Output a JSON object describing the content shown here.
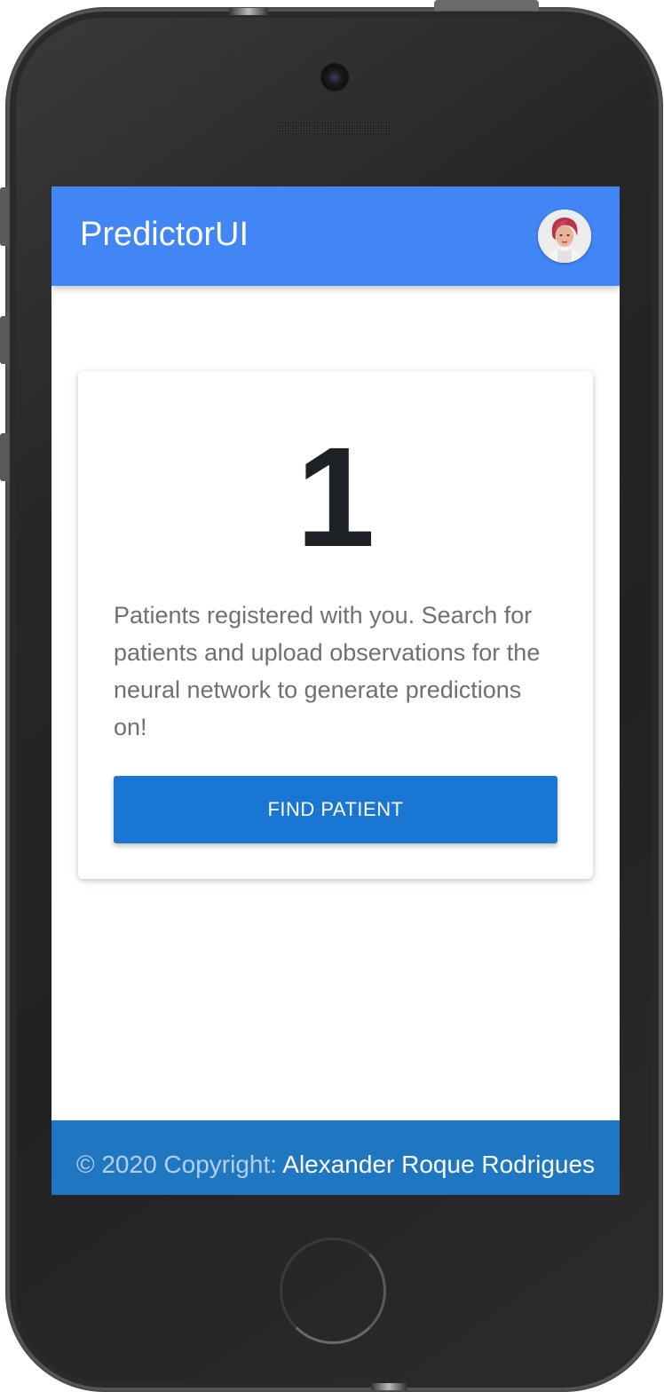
{
  "app": {
    "title": "PredictorUI",
    "avatar_icon": "user-avatar-icon"
  },
  "summary_card": {
    "count": "1",
    "description": "Patients registered with you. Search for patients and upload observations for the neural network to generate predictions on!",
    "button_label": "FIND PATIENT"
  },
  "footer": {
    "copyright": "© 2020 Copyright:",
    "author": "Alexander Roque Rodrigues"
  },
  "colors": {
    "appbar": "#4285f4",
    "button": "#1976d2",
    "footer": "#1f77c2"
  }
}
